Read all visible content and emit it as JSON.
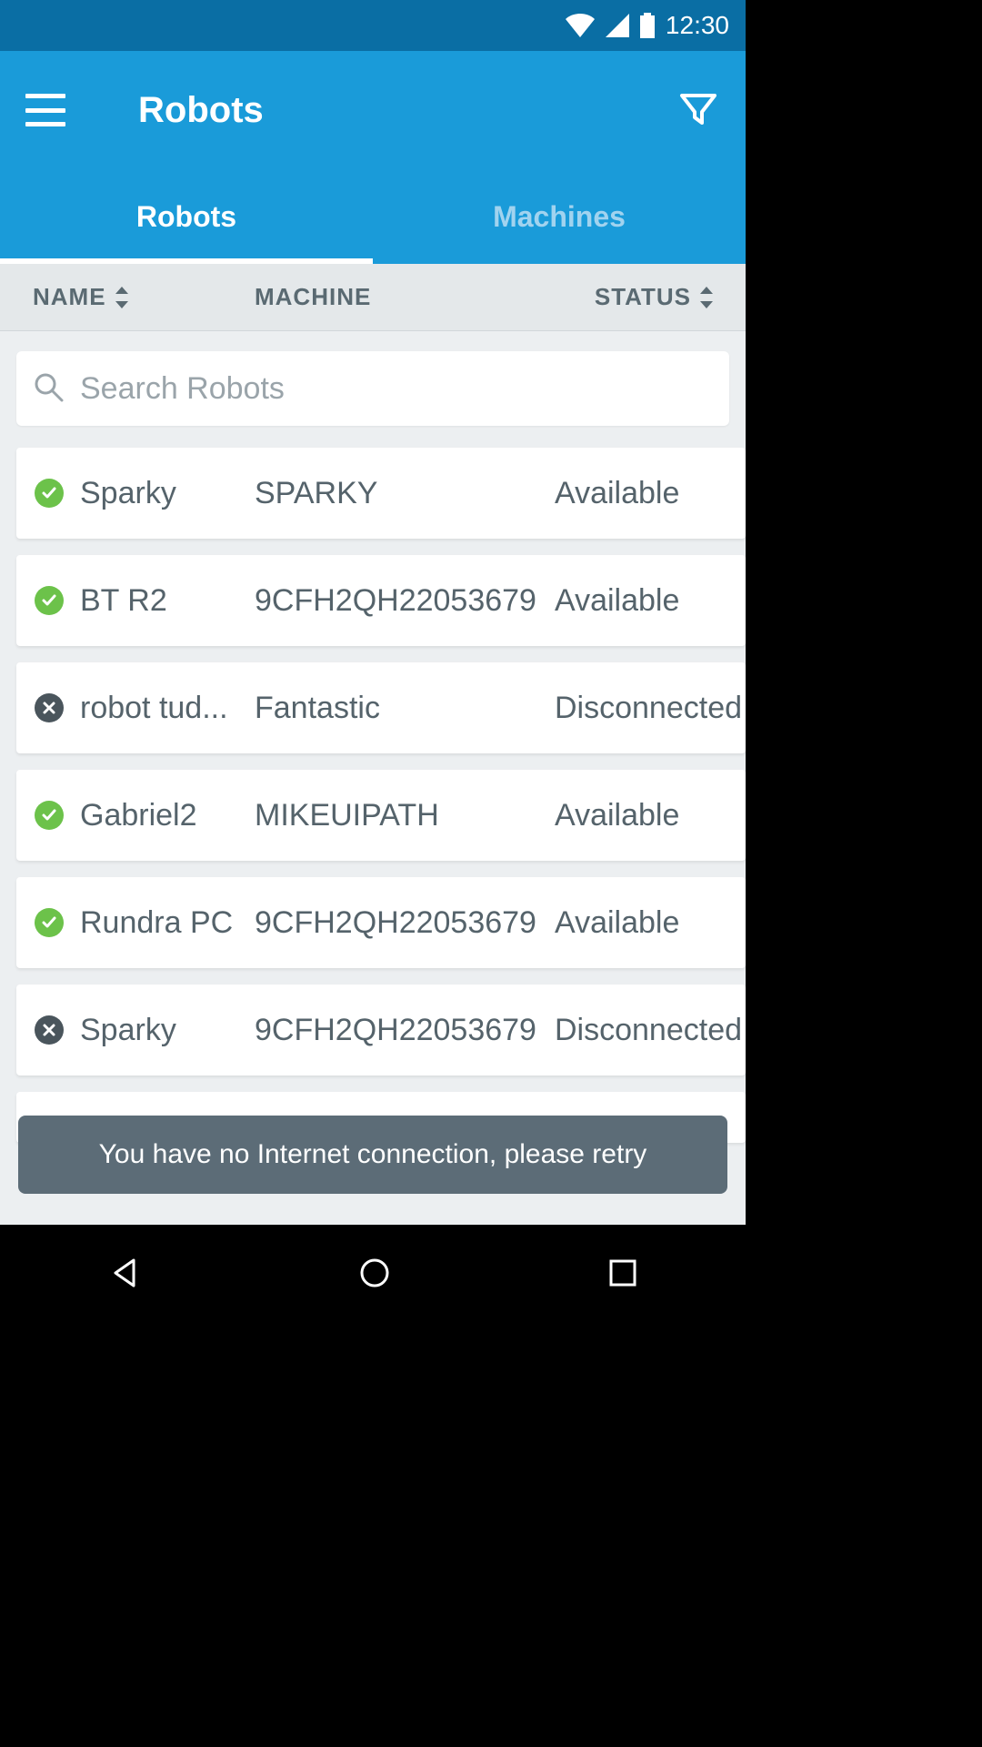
{
  "status_bar": {
    "time": "12:30"
  },
  "app_bar": {
    "title": "Robots"
  },
  "tabs": [
    {
      "label": "Robots",
      "active": true
    },
    {
      "label": "Machines",
      "active": false
    }
  ],
  "columns": {
    "name": "NAME",
    "machine": "MACHINE",
    "status": "STATUS"
  },
  "search": {
    "placeholder": "Search Robots"
  },
  "robots": [
    {
      "name": "Sparky",
      "machine": "SPARKY",
      "status": "Available",
      "state": "available"
    },
    {
      "name": "BT R2",
      "machine": "9CFH2QH22053679",
      "status": "Available",
      "state": "available"
    },
    {
      "name": "robot tud...",
      "machine": "Fantastic",
      "status": "Disconnected",
      "state": "disconnected"
    },
    {
      "name": "Gabriel2",
      "machine": "MIKEUIPATH",
      "status": "Available",
      "state": "available"
    },
    {
      "name": "Rundra PC",
      "machine": "9CFH2QH22053679",
      "status": "Available",
      "state": "available"
    },
    {
      "name": "Sparky",
      "machine": "9CFH2QH22053679",
      "status": "Disconnected",
      "state": "disconnected"
    }
  ],
  "snackbar": {
    "message": "You have no Internet connection, please retry"
  }
}
